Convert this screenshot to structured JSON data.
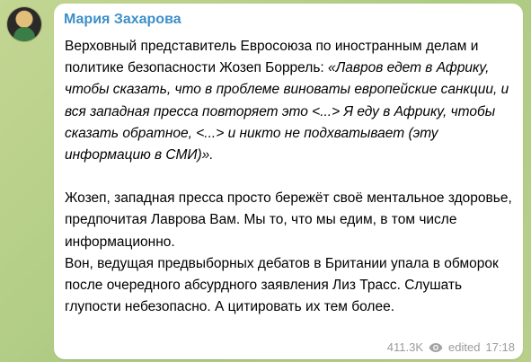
{
  "post": {
    "sender": "Мария Захарова",
    "paragraph1_plain": "Верховный представитель Евросоюза по иностранным делам и политике безопасности Жозеп Боррель: ",
    "paragraph1_quote": "«Лавров едет в Африку, чтобы сказать, что в проблеме виноваты европейские санкции, и вся западная пресса повторяет это <...> Я еду в Африку, чтобы сказать обратное, <...> и никто не подхватывает (эту информацию в СМИ)».",
    "paragraph2": "Жозеп, западная пресса просто бережёт своё ментальное здоровье, предпочитая Лаврова Вам. Мы то, что мы едим, в том числе информационно.",
    "paragraph3": "Вон, ведущая предвыборных дебатов в Британии упала в обморок после очередного абсурдного заявления Лиз Трасс. Слушать глупости небезопасно. А цитировать их тем более."
  },
  "meta": {
    "views": "411.3K",
    "edited": "edited",
    "time": "17:18",
    "views_icon": "eye-icon"
  },
  "colors": {
    "sender": "#3d8fc9",
    "bubble": "#ffffff",
    "meta": "#9b9b9b"
  }
}
